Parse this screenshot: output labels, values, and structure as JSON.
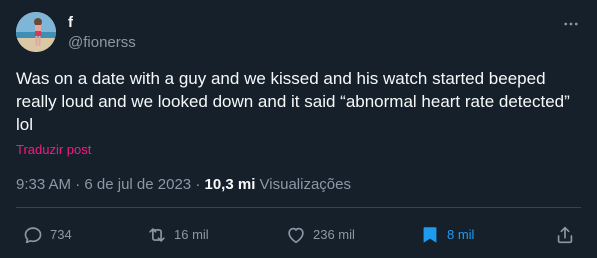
{
  "author": {
    "display_name": "f",
    "handle": "@fionerss"
  },
  "tweet": {
    "text": "Was on a date with a guy and we kissed and his watch started beeped really loud and we looked down and it said “abnormal heart rate detected” lol",
    "translate_label": "Traduzir post",
    "time": "9:33 AM",
    "date": "6 de jul de 2023",
    "separator": "·",
    "views_count": "10,3 mi",
    "views_label": "Visualizações"
  },
  "actions": {
    "replies": "734",
    "retweets": "16 mil",
    "likes": "236 mil",
    "bookmarks": "8 mil"
  },
  "icons": {
    "more": "more-horizontal-icon",
    "reply": "reply-icon",
    "retweet": "retweet-icon",
    "like": "heart-icon",
    "bookmark": "bookmark-icon",
    "share": "share-icon"
  },
  "colors": {
    "background": "#15202b",
    "text_primary": "#f7f9f9",
    "text_secondary": "#8b98a5",
    "translate_link": "#f91880",
    "bookmark_active": "#1d9bf0",
    "divider": "#38444d"
  }
}
